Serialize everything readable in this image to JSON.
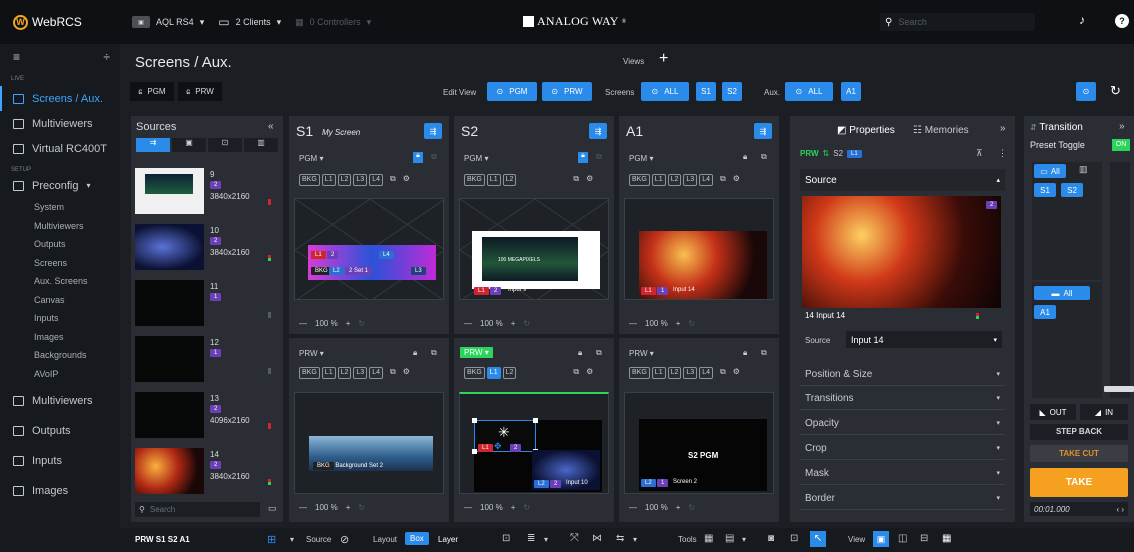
{
  "topbar": {
    "app_name": "WebRCS",
    "device": "AQL RS4",
    "clients": "2 Clients",
    "controllers": "0 Controllers",
    "brand": "ANALOG WAY",
    "search_placeholder": "Search",
    "help": "?"
  },
  "sidebar": {
    "sections": [
      "LIVE",
      "SETUP"
    ],
    "items": [
      {
        "label": "Screens / Aux."
      },
      {
        "label": "Multiviewers"
      },
      {
        "label": "Virtual RC400T"
      },
      {
        "label": "Preconfig"
      }
    ],
    "sub_items": [
      "System",
      "Multiviewers",
      "Outputs",
      "Screens",
      "Aux. Screens",
      "Canvas",
      "Inputs",
      "Images",
      "Backgrounds",
      "AVoIP"
    ],
    "bottom_items": [
      "Multiviewers",
      "Outputs",
      "Inputs",
      "Images"
    ]
  },
  "header": {
    "title": "Screens / Aux.",
    "views_label": "Views",
    "add": "+",
    "pgm": "PGM",
    "prw": "PRW",
    "edit_view": "Edit View",
    "screens_label": "Screens",
    "aux_label": "Aux.",
    "all": "ALL",
    "s1": "S1",
    "s2": "S2",
    "a1": "A1"
  },
  "sources": {
    "title": "Sources",
    "search_placeholder": "Search",
    "items": [
      {
        "num": "9",
        "layer": "2",
        "res": "3840x2160"
      },
      {
        "num": "10",
        "layer": "2",
        "res": "3840x2160"
      },
      {
        "num": "11",
        "layer": "1",
        "res": ""
      },
      {
        "num": "12",
        "layer": "1",
        "res": ""
      },
      {
        "num": "13",
        "layer": "2",
        "res": "4096x2160"
      },
      {
        "num": "14",
        "layer": "2",
        "res": "3840x2160"
      }
    ]
  },
  "screens": [
    {
      "name": "S1",
      "subtitle": "My Screen",
      "pgm": "PGM",
      "prw": "PRW",
      "layers_pgm": [
        "BKG",
        "L1",
        "L2",
        "L3",
        "L4"
      ],
      "layers_prw": [
        "BKG",
        "L1",
        "L2",
        "L3",
        "L4"
      ],
      "zoom": "100",
      "pgm_tags": {
        "l1": "L1",
        "n2": "2",
        "l4": "L4",
        "l2": "L2",
        "l3": "L3",
        "bkg": "BKG",
        "set": "2 Set 1"
      },
      "prw_caption": "Background Set 2",
      "prw_bkg": "BKG"
    },
    {
      "name": "S2",
      "subtitle": "",
      "pgm": "PGM",
      "prw": "PRW",
      "layers_pgm": [
        "BKG",
        "L1",
        "L2"
      ],
      "layers_prw": [
        "BKG",
        "L1",
        "L2"
      ],
      "zoom": "100",
      "pgm_caption": "Input 9",
      "pgm_l1": "L1",
      "pgm_n2": "2",
      "pgm_img_text": "100 MEGAPIXELS",
      "prw_l1": "L1",
      "prw_n2": "2",
      "prw_l2": "L2",
      "prw_input": "Input 10"
    },
    {
      "name": "A1",
      "subtitle": "",
      "pgm": "PGM",
      "prw": "PRW",
      "layers_pgm": [
        "BKG",
        "L1",
        "L2",
        "L3",
        "L4"
      ],
      "layers_prw": [
        "BKG",
        "L1",
        "L2",
        "L3",
        "L4"
      ],
      "zoom": "100",
      "pgm_caption": "Input 14",
      "pgm_l1": "L1",
      "pgm_n1": "1",
      "prw_label": "S2 PGM",
      "prw_screen": "Screen 2",
      "prw_l2": "L2",
      "prw_n1": "1"
    }
  ],
  "properties": {
    "tab_properties": "Properties",
    "tab_memories": "Memories",
    "prw": "PRW",
    "s2": "S2",
    "l1": "L1",
    "source_header": "Source",
    "thumb_caption": "14 Input 14",
    "thumb_badge": "2",
    "source_label": "Source",
    "source_value": "Input 14",
    "sections": [
      "Position & Size",
      "Transitions",
      "Opacity",
      "Crop",
      "Mask",
      "Border"
    ]
  },
  "transition": {
    "title": "Transition",
    "preset_toggle": "Preset Toggle",
    "on": "ON",
    "all": "All",
    "s1": "S1",
    "s2": "S2",
    "a1": "A1",
    "out": "OUT",
    "in": "IN",
    "step_back": "STEP BACK",
    "take_cut": "TAKE CUT",
    "take": "TAKE",
    "time": "00:01.000"
  },
  "bottombar": {
    "status": "PRW S1 S2 A1",
    "source": "Source",
    "layout": "Layout",
    "box": "Box",
    "layer": "Layer",
    "tools": "Tools",
    "view": "View"
  }
}
